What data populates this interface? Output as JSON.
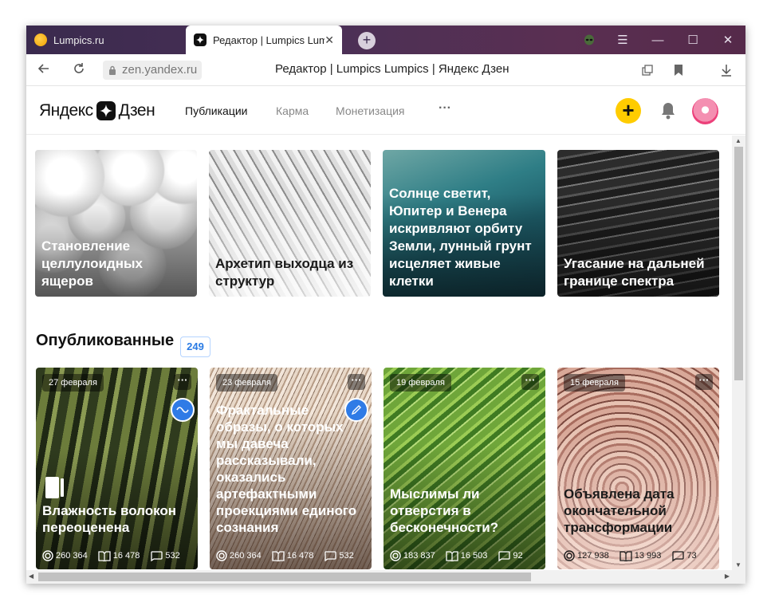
{
  "browser": {
    "tabs": [
      {
        "title": "Lumpics.ru"
      },
      {
        "title": "Редактор | Lumpics Lumpics"
      }
    ],
    "tab_close": "✕",
    "new_tab": "+",
    "url": "zen.yandex.ru",
    "page_title": "Редактор | Lumpics Lumpics | Яндекс Дзен",
    "controls": {
      "menu": "☰",
      "minimize": "—",
      "maximize": "☐",
      "close": "✕"
    }
  },
  "zen": {
    "logo_left": "Яндекс",
    "logo_right": "Дзен",
    "nav": [
      {
        "label": "Публикации"
      },
      {
        "label": "Карма"
      },
      {
        "label": "Монетизация"
      },
      {
        "label": "···"
      }
    ],
    "plus": "+"
  },
  "drafts": [
    {
      "title": "Становление целлулоидных ящеров",
      "image": "white-spheres"
    },
    {
      "title": "Архетип выходца из структур",
      "image": "architecture"
    },
    {
      "title": "Солнце светит, Юпитер и Венера искривляют орбиту Земли, лунный грунт исцеляет живые клетки",
      "image": "teal-cells"
    },
    {
      "title": "Угасание на дальней границе спектра",
      "image": "dark-water"
    }
  ],
  "published": {
    "title": "Опубликованные",
    "count": "249",
    "more": "···",
    "cards": [
      {
        "date": "27 февраля",
        "title": "Влажность волокон переоценена",
        "views": "260 364",
        "reads": "16 478",
        "comments": "532",
        "type_icon": "wave-icon"
      },
      {
        "date": "23 февраля",
        "title": "Фрактальные образы, о которых мы давеча рассказывали, оказались артефактными проекциями единого сознания",
        "views": "260 364",
        "reads": "16 478",
        "comments": "532",
        "type_icon": "pencil-icon"
      },
      {
        "date": "19 февраля",
        "title": "Мыслимы ли отверстия в бесконечности?",
        "views": "183 837",
        "reads": "16 503",
        "comments": "92"
      },
      {
        "date": "15 февраля",
        "title": "Объявлена дата окончательной трансформации",
        "views": "127 938",
        "reads": "13 993",
        "comments": "73"
      }
    ]
  },
  "colors": {
    "accent_yellow": "#ffcc00",
    "link_blue": "#2f7be6"
  }
}
